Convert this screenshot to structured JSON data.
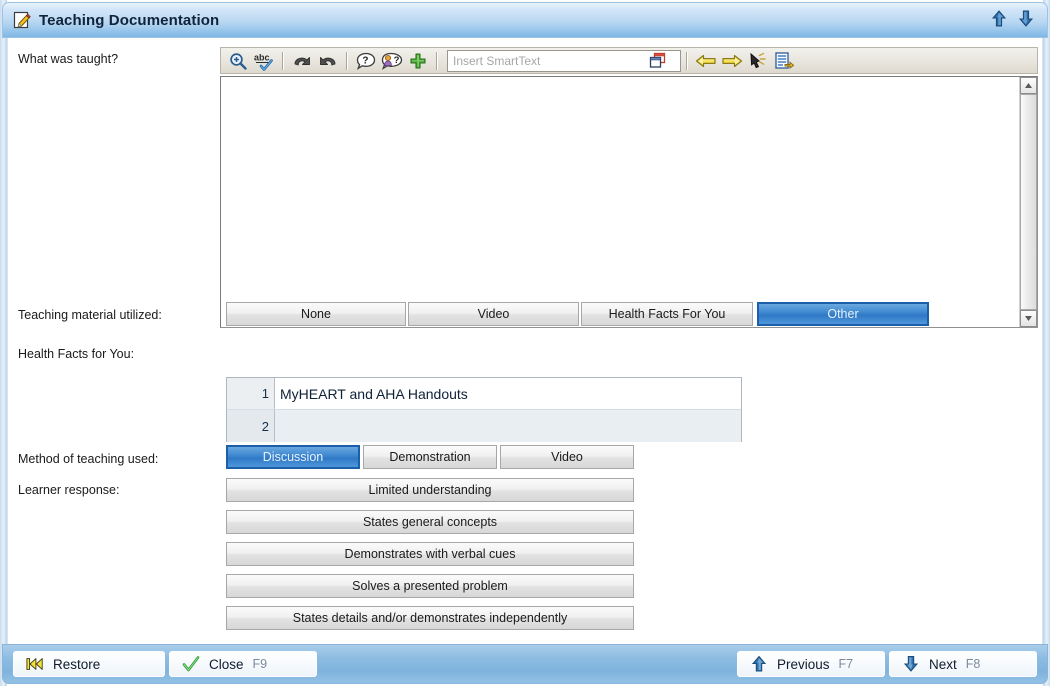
{
  "window": {
    "title": "Teaching Documentation",
    "title_icon": "document-pencil-icon",
    "scroll_up_icon": "arrow-up-icon",
    "scroll_down_icon": "arrow-down-icon"
  },
  "editor": {
    "label": "What was taught?",
    "value": "",
    "toolbar": {
      "buttons": [
        {
          "name": "zoom-in-icon",
          "title": "Zoom"
        },
        {
          "name": "spell-check-icon",
          "title": "Spell Check"
        },
        {
          "name": "undo-icon",
          "title": "Undo"
        },
        {
          "name": "redo-icon",
          "title": "Redo"
        },
        {
          "name": "help-bubble-icon",
          "title": "Help"
        },
        {
          "name": "patient-question-icon",
          "title": "Patient Info"
        },
        {
          "name": "add-plus-icon",
          "title": "Add"
        }
      ],
      "smarttext_placeholder": "Insert SmartText",
      "smarttext_value": "",
      "smarttext_icon": "window-stack-icon",
      "right_buttons": [
        {
          "name": "back-arrow-icon",
          "title": "Back"
        },
        {
          "name": "forward-arrow-icon",
          "title": "Forward"
        },
        {
          "name": "pointer-hand-icon",
          "title": "Select"
        },
        {
          "name": "document-export-icon",
          "title": "Export"
        }
      ]
    }
  },
  "teaching_material": {
    "label": "Teaching material utilized:",
    "options": [
      {
        "label": "None",
        "selected": false
      },
      {
        "label": "Video",
        "selected": false
      },
      {
        "label": "Health Facts For You",
        "selected": false
      },
      {
        "label": "Other",
        "selected": true
      }
    ]
  },
  "health_facts": {
    "label": "Health Facts for You:",
    "rows": [
      {
        "num": "1",
        "value": "MyHEART and AHA Handouts"
      },
      {
        "num": "2",
        "value": ""
      }
    ]
  },
  "method_of_teaching": {
    "label": "Method of teaching used:",
    "options": [
      {
        "label": "Discussion",
        "selected": true
      },
      {
        "label": "Demonstration",
        "selected": false
      },
      {
        "label": "Video",
        "selected": false
      }
    ]
  },
  "learner_response": {
    "label": "Learner response:",
    "options": [
      {
        "label": "Limited understanding",
        "selected": false
      },
      {
        "label": "States general concepts",
        "selected": false
      },
      {
        "label": "Demonstrates with verbal cues",
        "selected": false
      },
      {
        "label": "Solves a presented problem",
        "selected": false
      },
      {
        "label": "States details and/or demonstrates independently",
        "selected": false
      }
    ]
  },
  "statusbar": {
    "left": [
      {
        "label": "Restore",
        "key": "",
        "icon": "rewind-icon"
      },
      {
        "label": "Close",
        "key": "F9",
        "icon": "green-check-icon"
      }
    ],
    "right": [
      {
        "label": "Previous",
        "key": "F7",
        "icon": "arrow-up-icon"
      },
      {
        "label": "Next",
        "key": "F8",
        "icon": "arrow-down-icon"
      }
    ]
  },
  "colors": {
    "accent_blue": "#3d86cf",
    "selected_border": "#1b5fa8",
    "titlebar_blue": "#a6cdee",
    "statusbar_blue": "#8dbce2",
    "button_face": "#f1f1f1"
  }
}
